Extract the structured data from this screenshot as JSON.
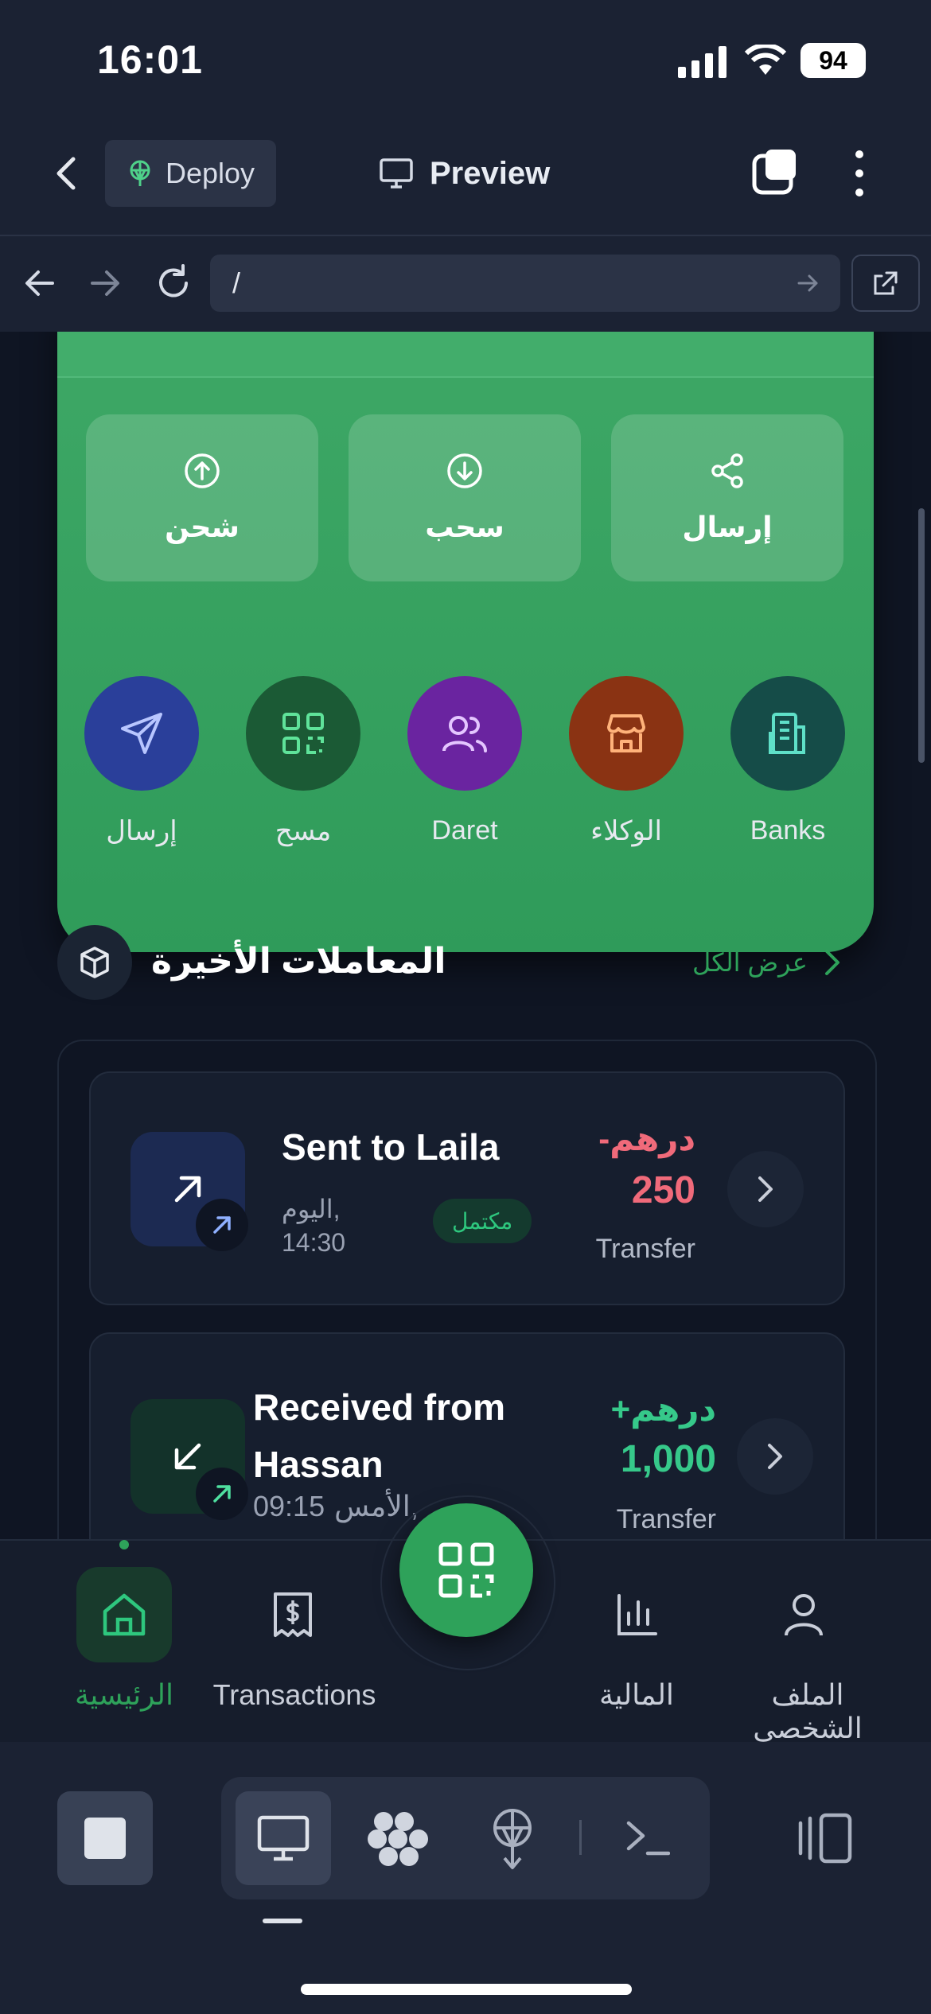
{
  "status_bar": {
    "time": "16:01",
    "battery": "94"
  },
  "header": {
    "deploy_label": "Deploy",
    "preview_label": "Preview"
  },
  "browser": {
    "url": "/"
  },
  "quick_actions": [
    {
      "label": "شحن",
      "icon": "arrow-up-circle-icon"
    },
    {
      "label": "سحب",
      "icon": "arrow-down-circle-icon"
    },
    {
      "label": "إرسال",
      "icon": "share-icon"
    }
  ],
  "services": [
    {
      "label": "إرسال",
      "icon": "send-icon",
      "color": "#2a3f9a"
    },
    {
      "label": "مسح",
      "icon": "qr-icon",
      "color": "#1b5a35"
    },
    {
      "label": "Daret",
      "icon": "users-icon",
      "color": "#6a24a0"
    },
    {
      "label": "الوكلاء",
      "icon": "store-icon",
      "color": "#8a3313"
    },
    {
      "label": "Banks",
      "icon": "bank-icon",
      "color": "#154c48"
    }
  ],
  "recent": {
    "title": "المعاملات الأخيرة",
    "view_all": "عرض الكل"
  },
  "transactions": [
    {
      "title": "Sent to Laila",
      "date_label": "اليوم,",
      "time": "14:30",
      "status": "مكتمل",
      "amount_sign": "-درهم",
      "amount_value": "250",
      "type": "Transfer",
      "color": "#f06a7a"
    },
    {
      "title_line1": "Received from",
      "title_line2": "Hassan",
      "date_label": "الأمس,",
      "time": "09:15",
      "amount_sign": "+درهم",
      "amount_value": "1,000",
      "type": "Transfer",
      "color": "#36c98a"
    }
  ],
  "bottom_nav": {
    "home": "الرئيسية",
    "transactions": "Transactions",
    "finance": "المالية",
    "profile": "الملف الشخصي"
  },
  "colors": {
    "accent": "#2ea25a",
    "background": "#0f1523"
  }
}
